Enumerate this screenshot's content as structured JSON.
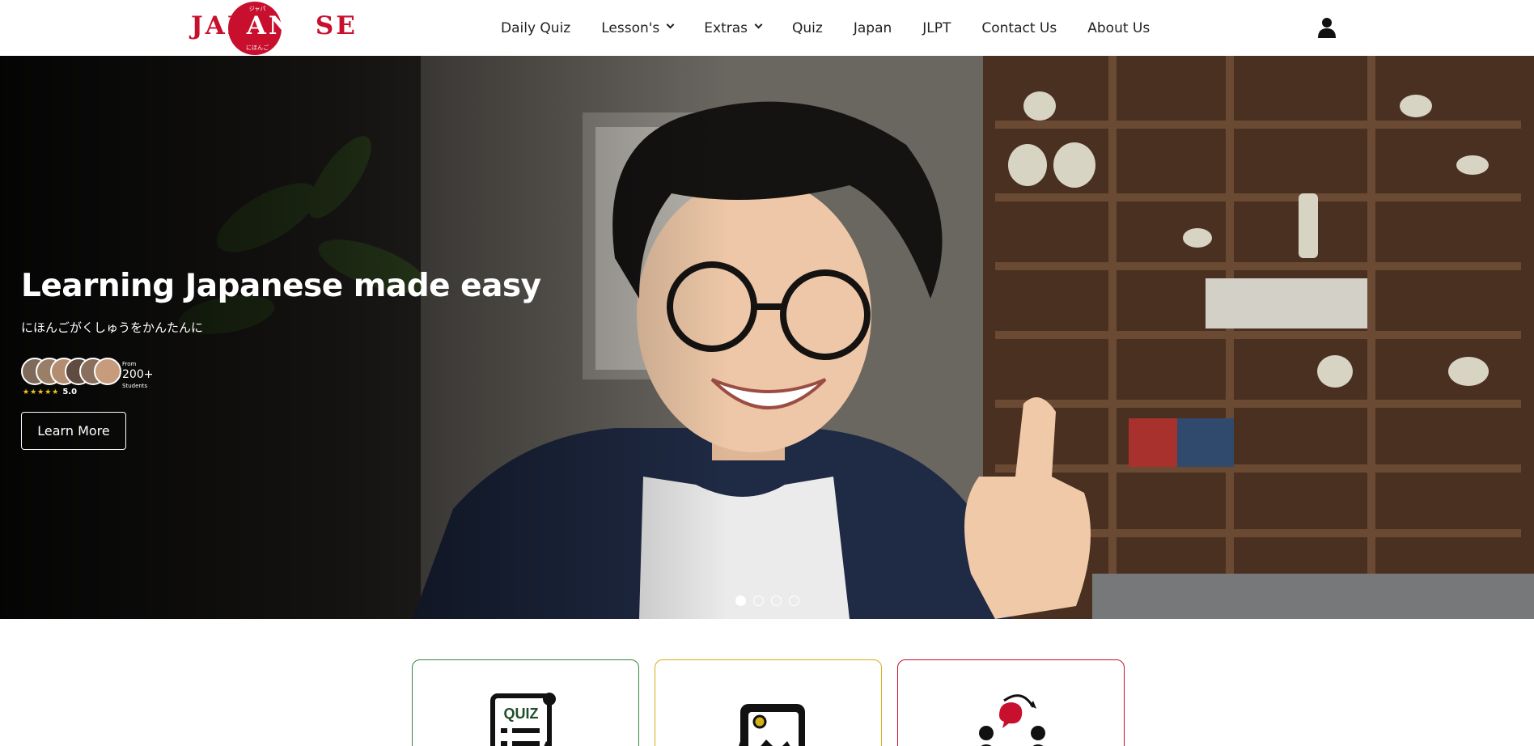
{
  "brand": {
    "name_prefix": "JAP",
    "name_red": "ANE",
    "name_suffix": "SE",
    "kana_top": "ジャパ",
    "kana_bottom": "にほんご",
    "accent_color": "#c8102e"
  },
  "nav": {
    "items": [
      {
        "label": "Daily Quiz",
        "dropdown": false
      },
      {
        "label": "Lesson's",
        "dropdown": true
      },
      {
        "label": "Extras",
        "dropdown": true
      },
      {
        "label": "Quiz",
        "dropdown": false
      },
      {
        "label": "Japan",
        "dropdown": false
      },
      {
        "label": "JLPT",
        "dropdown": false
      },
      {
        "label": "Contact Us",
        "dropdown": false
      },
      {
        "label": "About Us",
        "dropdown": false
      }
    ],
    "user_icon": "user-icon"
  },
  "hero": {
    "title": "Learning Japanese made easy",
    "subtitle": "にほんごがくしゅうをかんたんに",
    "rating": "5.0",
    "stars": "★★★★★",
    "from_label": "From",
    "student_count": "200+",
    "students_label": "Students",
    "cta_label": "Learn More",
    "slides_total": 4,
    "active_slide": 1
  },
  "cards": [
    {
      "icon": "quiz-icon",
      "label": "QUIZ",
      "border_color": "#2e8b3a"
    },
    {
      "icon": "picture-icon",
      "border_color": "#d4b017"
    },
    {
      "icon": "community-icon",
      "border_color": "#c8102e"
    }
  ]
}
